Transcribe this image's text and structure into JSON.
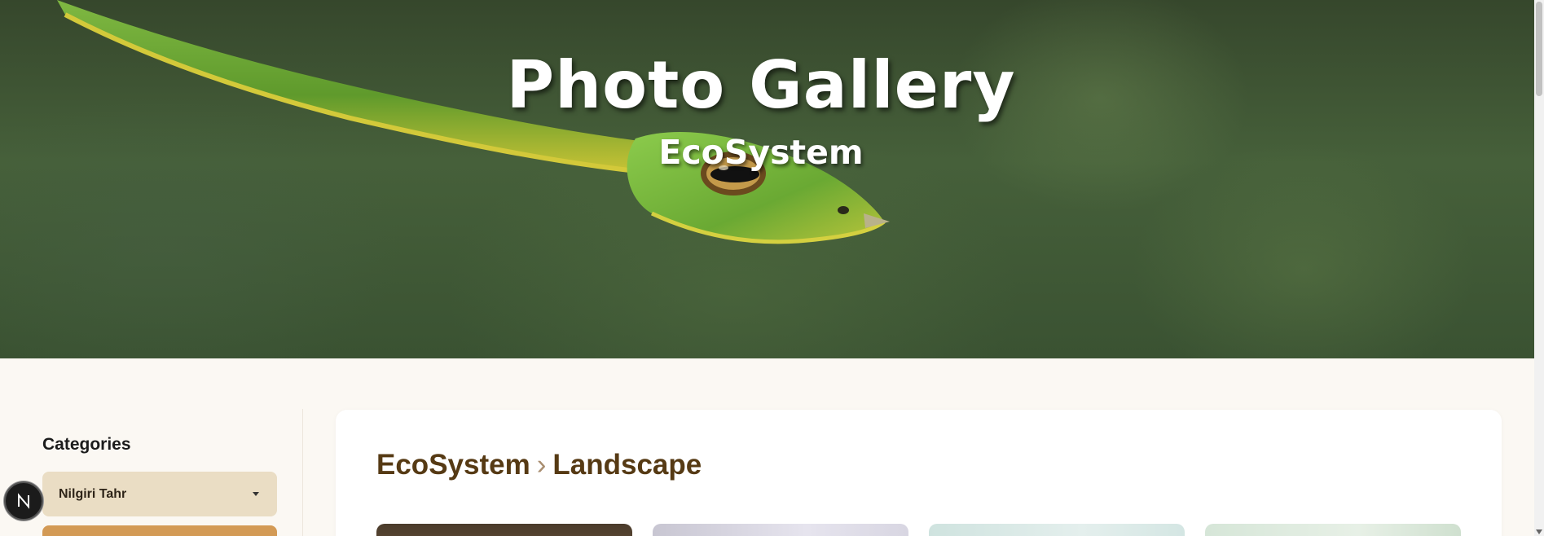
{
  "hero": {
    "title": "Photo Gallery",
    "subtitle": "EcoSystem"
  },
  "sidebar": {
    "heading": "Categories",
    "selected_category": "Nilgiri Tahr"
  },
  "badge": {
    "letter": "N"
  },
  "main": {
    "breadcrumb": {
      "section": "EcoSystem",
      "separator": "›",
      "current": "Landscape"
    }
  },
  "colors": {
    "breadcrumb_text": "#563a14",
    "category_select_bg": "#eaddc4",
    "category_next_bg": "#d39a55",
    "page_bg": "#fbf8f3"
  },
  "icons": [
    "snake-hero-image",
    "caret-down-icon",
    "n-logo-icon"
  ]
}
